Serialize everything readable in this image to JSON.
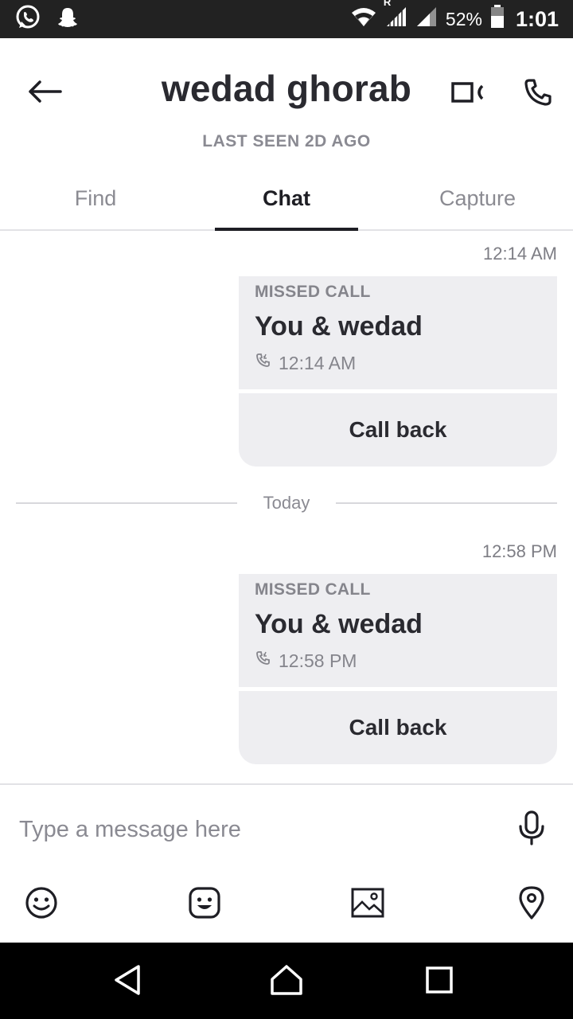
{
  "status_bar": {
    "icons_left": [
      "whatsapp-icon",
      "snapchat-icon"
    ],
    "icons_right": [
      "wifi-icon",
      "signal-icon",
      "signal-icon",
      "battery-icon"
    ],
    "roaming_indicator": "R",
    "battery_percent": "52%",
    "time": "1:01"
  },
  "header": {
    "back_icon": "arrow-left-icon",
    "contact_name": "wedad ghorab",
    "last_seen": "LAST SEEN 2D AGO",
    "video_icon": "video-call-icon",
    "phone_icon": "phone-icon"
  },
  "tabs": [
    {
      "label": "Find",
      "active": false
    },
    {
      "label": "Chat",
      "active": true
    },
    {
      "label": "Capture",
      "active": false
    }
  ],
  "messages": [
    {
      "timestamp": "12:14 AM",
      "type_label": "MISSED CALL",
      "participants": "You & wedad",
      "call_time": "12:14 AM",
      "action_label": "Call back"
    },
    {
      "timestamp": "12:58 PM",
      "type_label": "MISSED CALL",
      "participants": "You & wedad",
      "call_time": "12:58 PM",
      "action_label": "Call back"
    }
  ],
  "date_divider": "Today",
  "composer": {
    "placeholder": "Type a message here",
    "value": "",
    "mic_icon": "microphone-icon",
    "tools": [
      "emoji-icon",
      "sticker-icon",
      "image-icon",
      "location-pin-icon"
    ]
  },
  "nav_bar": {
    "buttons": [
      "back-triangle-icon",
      "home-icon",
      "recents-icon"
    ]
  },
  "colors": {
    "status_bar_bg": "#222222",
    "bubble_bg": "#eeeef1",
    "text_primary": "#2a2a30",
    "text_secondary": "#8a8a92",
    "nav_bar_bg": "#000000"
  }
}
